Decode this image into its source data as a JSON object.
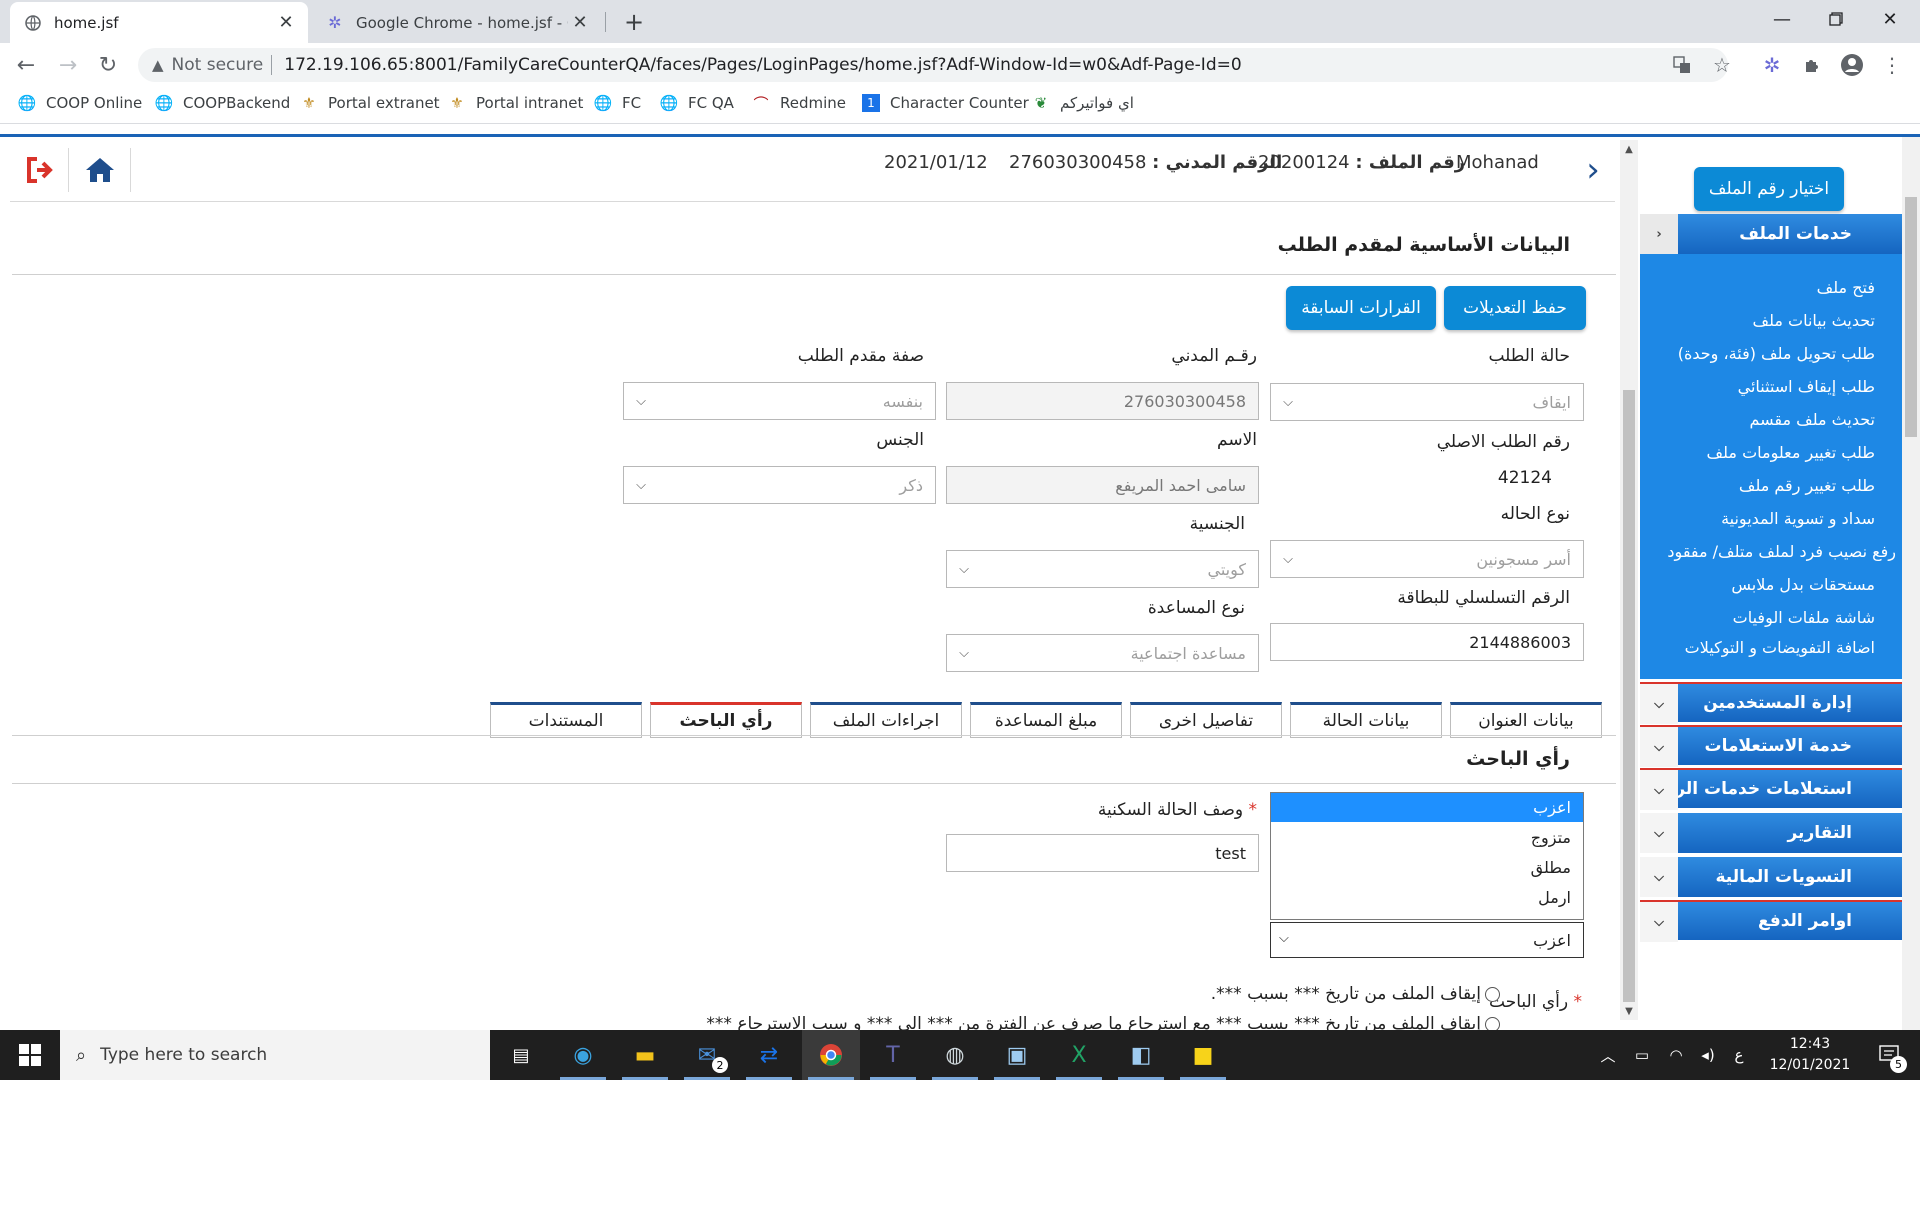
{
  "browser": {
    "tabs": [
      {
        "title": "home.jsf"
      },
      {
        "title": "Google Chrome - home.jsf - Goo"
      }
    ],
    "omnibox": {
      "security": "Not secure",
      "url": "172.19.106.65:8001/FamilyCareCounterQA/faces/Pages/LoginPages/home.jsf?Adf-Window-Id=w0&Adf-Page-Id=0"
    },
    "bookmarks": [
      "COOP Online",
      "COOPBackend",
      "Portal extranet",
      "Portal intranet",
      "FC",
      "FC QA",
      "Redmine",
      "Character Counter",
      "اي فواتيركم"
    ]
  },
  "header": {
    "user": "Mohanad",
    "file_label": "رقم الملف :",
    "file_no": "20200124",
    "civil_label": "الرقم المدني :",
    "civil_no": "276030300458",
    "date": "2021/01/12"
  },
  "section": {
    "title": "البيانات الأساسية لمقدم الطلب",
    "save_button": "حفظ التعديلات",
    "previous_button": "القرارات السابقة"
  },
  "form": {
    "request_status": {
      "label": "حالة الطلب",
      "value": "ايقاف"
    },
    "civil_id": {
      "label": "رقـم المدني",
      "value": "276030300458"
    },
    "applicant_capacity": {
      "label": "صفة مقدم الطلب",
      "value": "بنفسه"
    },
    "original_request_no": {
      "label": "رقم الطلب الاصلي",
      "value": "42124"
    },
    "name": {
      "label": "الاسم",
      "value": "سامى احمد المريفع"
    },
    "gender": {
      "label": "الجنس",
      "value": "ذكر"
    },
    "case_type": {
      "label": "نوع الحاله",
      "value": "أسر مسجونين"
    },
    "nationality": {
      "label": "الجنسية",
      "value": "كويتي"
    },
    "card_serial": {
      "label": "الرقم التسلسلي للبطاقة",
      "value": "2144886003"
    },
    "aid_type": {
      "label": "نوع المساعدة",
      "value": "مساعدة اجتماعية"
    }
  },
  "tabs": [
    {
      "label": "بيانات العنوان"
    },
    {
      "label": "بيانات الحالة"
    },
    {
      "label": "تفاصيل اخرى"
    },
    {
      "label": "مبلغ المساعدة"
    },
    {
      "label": "اجراءات الملف"
    },
    {
      "label": "رأي الباحث"
    },
    {
      "label": "المستندات"
    }
  ],
  "researcher": {
    "title": "رأي الباحث",
    "housing_label": "وصف الحالة السكنية",
    "housing_value": "test",
    "required_mark": "*",
    "marital_options": [
      "اعزب",
      "متزوج",
      "مطلق",
      "ارمل"
    ],
    "marital_selected": "اعزب",
    "opinion_label": "رأي الباحث",
    "radio1": "إيقاف الملف من تاريخ *** بسبب ***.",
    "radio2": "إيقاف الملف من تاريخ *** بسبب *** مع استرجاع ما صرف عن الفترة من *** الى *** و سبب الاسترجاع ***"
  },
  "sidebar": {
    "top_button": "اختيار رقم الملف",
    "file_services": "خدمات الملف",
    "items": [
      "فتح ملف",
      "تحديث بيانات ملف",
      "طلب تحويل ملف (فئة، وحدة)",
      "طلب إيقاف استثنائي",
      "تحديث ملف مقسم",
      "طلب تغيير معلومات ملف",
      "طلب تغيير رقم ملف",
      "سداد و تسوية المديونية",
      "رفع نصيب فرد لملف متلف/ مفقود",
      "مستحقات بدل ملابس",
      "شاشة ملفات الوفيات",
      "اضافة التفويضات و التوكيلات"
    ],
    "sections": [
      "إدارة المستخدمين",
      "خدمة الاستعلامات",
      "استعلامات خدمات الربط",
      "التقارير",
      "التسويات المالية",
      "اوامر الدفع"
    ]
  },
  "taskbar": {
    "search_placeholder": "Type here to search",
    "time": "12:43",
    "date": "12/01/2021",
    "lang": "ع",
    "notifications": "5",
    "mail_badge": "2"
  }
}
